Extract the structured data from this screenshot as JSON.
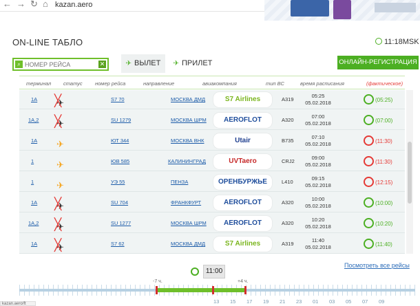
{
  "browser": {
    "url": "kazan.aero",
    "back": "←",
    "forward": "→",
    "reload": "↻",
    "home": "⌂"
  },
  "header": {
    "title": "ON-LINE ТАБЛО",
    "time": "11:18MSK"
  },
  "search": {
    "placeholder": "НОМЕР РЕЙСА",
    "clear": "✕"
  },
  "tabs": {
    "departure": "ВЫЛЕТ",
    "arrival": "ПРИЛЕТ"
  },
  "register_button": "ОНЛАЙН-РЕГИСТРАЦИЯ",
  "columns": {
    "terminal": "терминал",
    "status": "статус",
    "flight": "номер рейса",
    "direction": "направление",
    "airline": "авиакомпания",
    "aircraft": "тип ВС",
    "scheduled": "время расписания",
    "actual": "(фактическое)"
  },
  "flights": [
    {
      "terminal": "1A",
      "status": "cancelled",
      "flight": "S7 70",
      "direction": "МОСКВА ДМД",
      "airline": "S7 Airlines",
      "logo_color": "#7ab51d",
      "aircraft": "A319",
      "time": "05:25",
      "date": "05.02.2018",
      "actual": "(05:25)",
      "actual_color": "#4caf22"
    },
    {
      "terminal": "1A,2",
      "status": "cancelled",
      "flight": "SU 1279",
      "direction": "МОСКВА ШРМ",
      "airline": "AEROFLOT",
      "logo_color": "#1f4e9c",
      "aircraft": "A320",
      "time": "07:00",
      "date": "05.02.2018",
      "actual": "(07:00)",
      "actual_color": "#4caf22"
    },
    {
      "terminal": "1A",
      "status": "departed",
      "flight": "ЮТ 344",
      "direction": "МОСКВА ВНК",
      "airline": "Utair",
      "logo_color": "#1f3f8f",
      "aircraft": "B735",
      "time": "07:10",
      "date": "05.02.2018",
      "actual": "(11:30)",
      "actual_color": "#e53935"
    },
    {
      "terminal": "1",
      "status": "departed",
      "flight": "ЮВ 585",
      "direction": "КАЛИНИНГРАД",
      "airline": "UVTaero",
      "logo_color": "#c62828",
      "aircraft": "CRJ2",
      "time": "09:00",
      "date": "05.02.2018",
      "actual": "(11:30)",
      "actual_color": "#e53935"
    },
    {
      "terminal": "1",
      "status": "departed",
      "flight": "УЭ 55",
      "direction": "ПЕНЗА",
      "airline": "ОРЕНБУРЖЬЕ",
      "logo_color": "#1f4e9c",
      "aircraft": "L410",
      "time": "09:15",
      "date": "05.02.2018",
      "actual": "(12:15)",
      "actual_color": "#e53935"
    },
    {
      "terminal": "1A",
      "status": "cancelled",
      "flight": "SU 704",
      "direction": "ФРАНКФУРТ",
      "airline": "AEROFLOT",
      "logo_color": "#1f4e9c",
      "aircraft": "A320",
      "time": "10:00",
      "date": "05.02.2018",
      "actual": "(10:00)",
      "actual_color": "#4caf22"
    },
    {
      "terminal": "1A,2",
      "status": "cancelled",
      "flight": "SU 1277",
      "direction": "МОСКВА ШРМ",
      "airline": "AEROFLOT",
      "logo_color": "#1f4e9c",
      "aircraft": "A320",
      "time": "10:20",
      "date": "05.02.2018",
      "actual": "(10:20)",
      "actual_color": "#4caf22"
    },
    {
      "terminal": "1A",
      "status": "cancelled",
      "flight": "S7 62",
      "direction": "МОСКВА ДМД",
      "airline": "S7 Airlines",
      "logo_color": "#7ab51d",
      "aircraft": "A319",
      "time": "11:40",
      "date": "05.02.2018",
      "actual": "(11:40)",
      "actual_color": "#4caf22"
    }
  ],
  "footer": {
    "see_all": "Посмотреть все рейсы",
    "current_time": "11:00",
    "range_minus": "-7 ч.",
    "range_plus": "+4 ч.",
    "ticks": [
      "13",
      "15",
      "17",
      "19",
      "21",
      "23",
      "01",
      "03",
      "05",
      "07",
      "09"
    ],
    "status_text": "kazan.aero/ft"
  },
  "colors": {
    "accent": "#4caf22",
    "link": "#1a5aa8",
    "late": "#e53935"
  }
}
